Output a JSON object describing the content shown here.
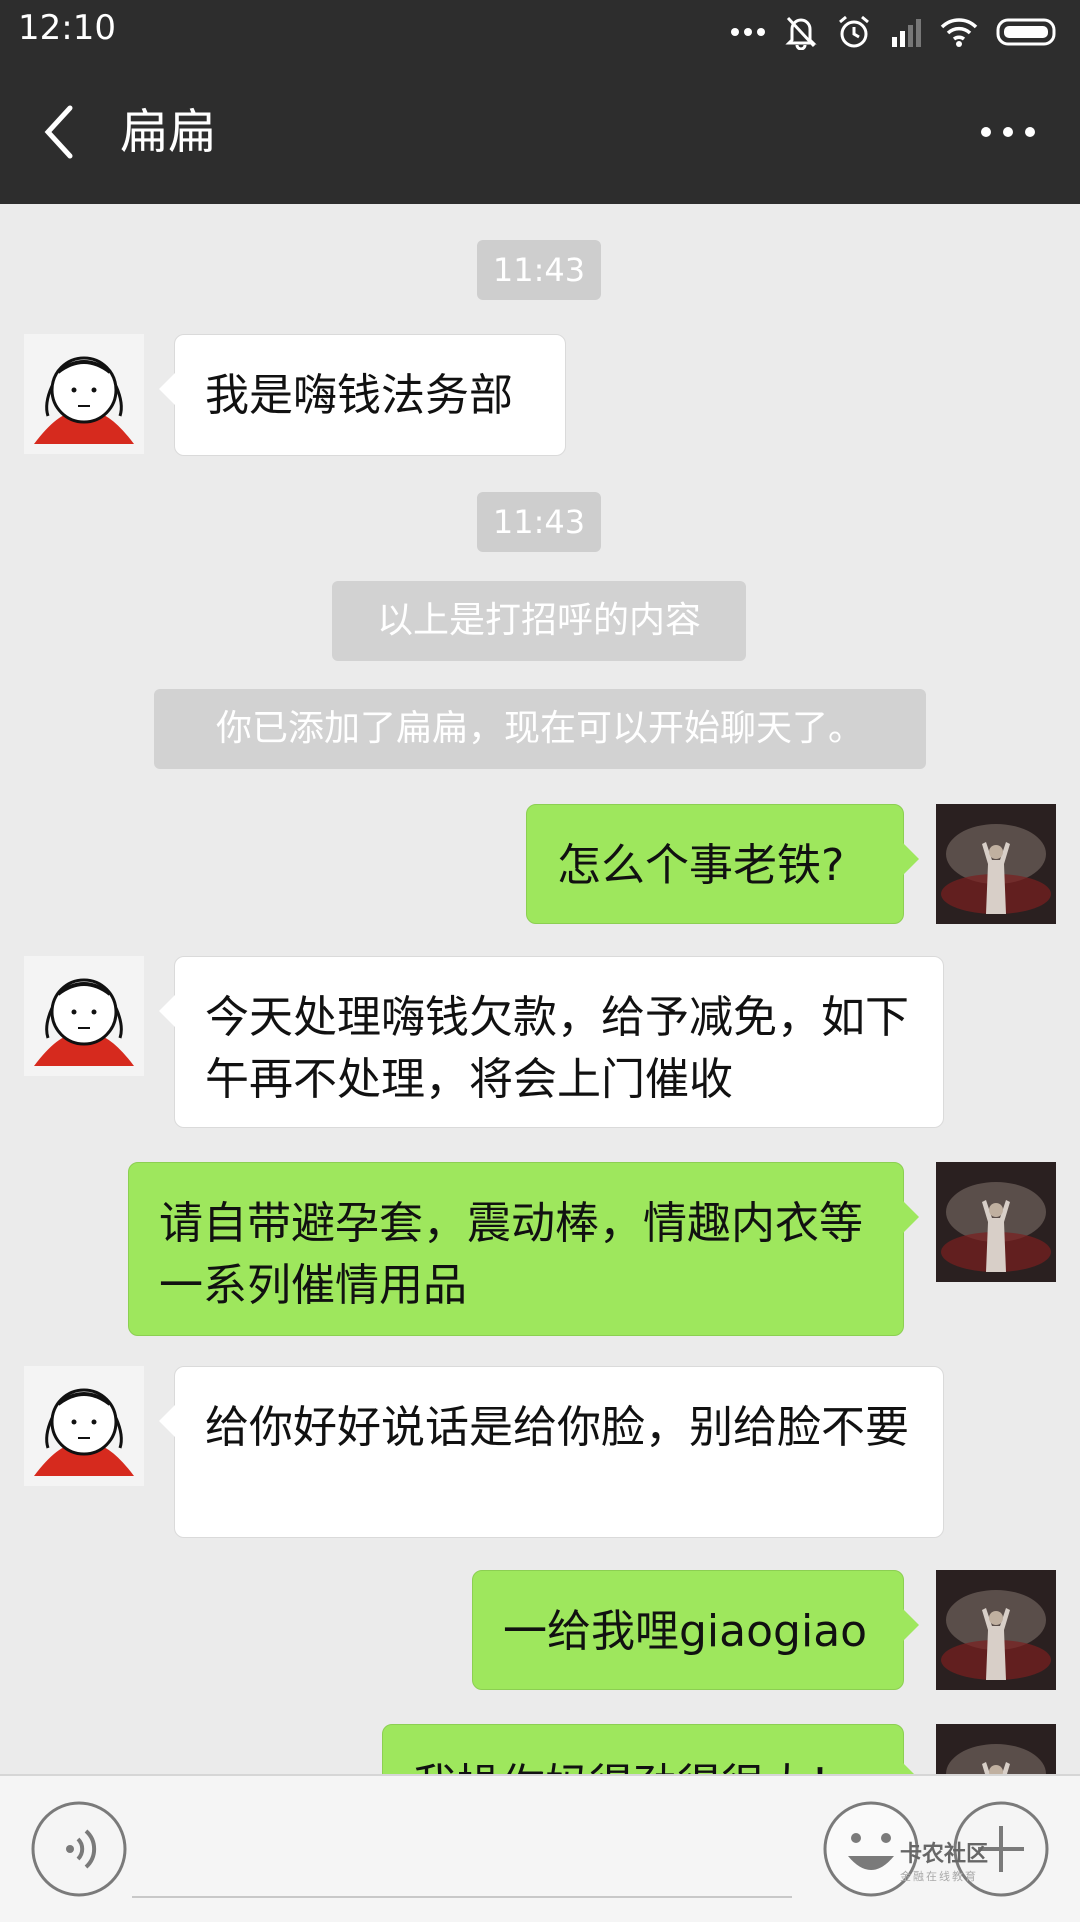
{
  "status_bar": {
    "time": "12:10"
  },
  "header": {
    "title": "扁扁"
  },
  "messages": [
    {
      "type": "time",
      "text": "11:43"
    },
    {
      "type": "bubble",
      "side": "left",
      "text": "我是嗨钱法务部"
    },
    {
      "type": "time",
      "text": "11:43"
    },
    {
      "type": "system",
      "text": "以上是打招呼的内容"
    },
    {
      "type": "system",
      "text": "你已添加了扁扁，现在可以开始聊天了。"
    },
    {
      "type": "bubble",
      "side": "right",
      "text": "怎么个事老铁?"
    },
    {
      "type": "bubble",
      "side": "left",
      "text": "今天处理嗨钱欠款，给予减免，如下午再不处理，将会上门催收"
    },
    {
      "type": "bubble",
      "side": "right",
      "text": "请自带避孕套，震动棒，情趣内衣等一系列催情用品"
    },
    {
      "type": "bubble",
      "side": "left",
      "text": "给你好好说话是给你脸，别给脸不要"
    },
    {
      "type": "bubble",
      "side": "right",
      "text": "一给我哩giaogiao"
    },
    {
      "type": "bubble",
      "side": "right",
      "text": "我操你妈得劲得很大！"
    }
  ],
  "watermark": {
    "name": "卡农社区",
    "tagline": "金融在线教育"
  },
  "colors": {
    "header_bg": "#2d2d2d",
    "chat_bg": "#ebebeb",
    "bubble_self": "#9ee75d",
    "bubble_other": "#ffffff"
  }
}
